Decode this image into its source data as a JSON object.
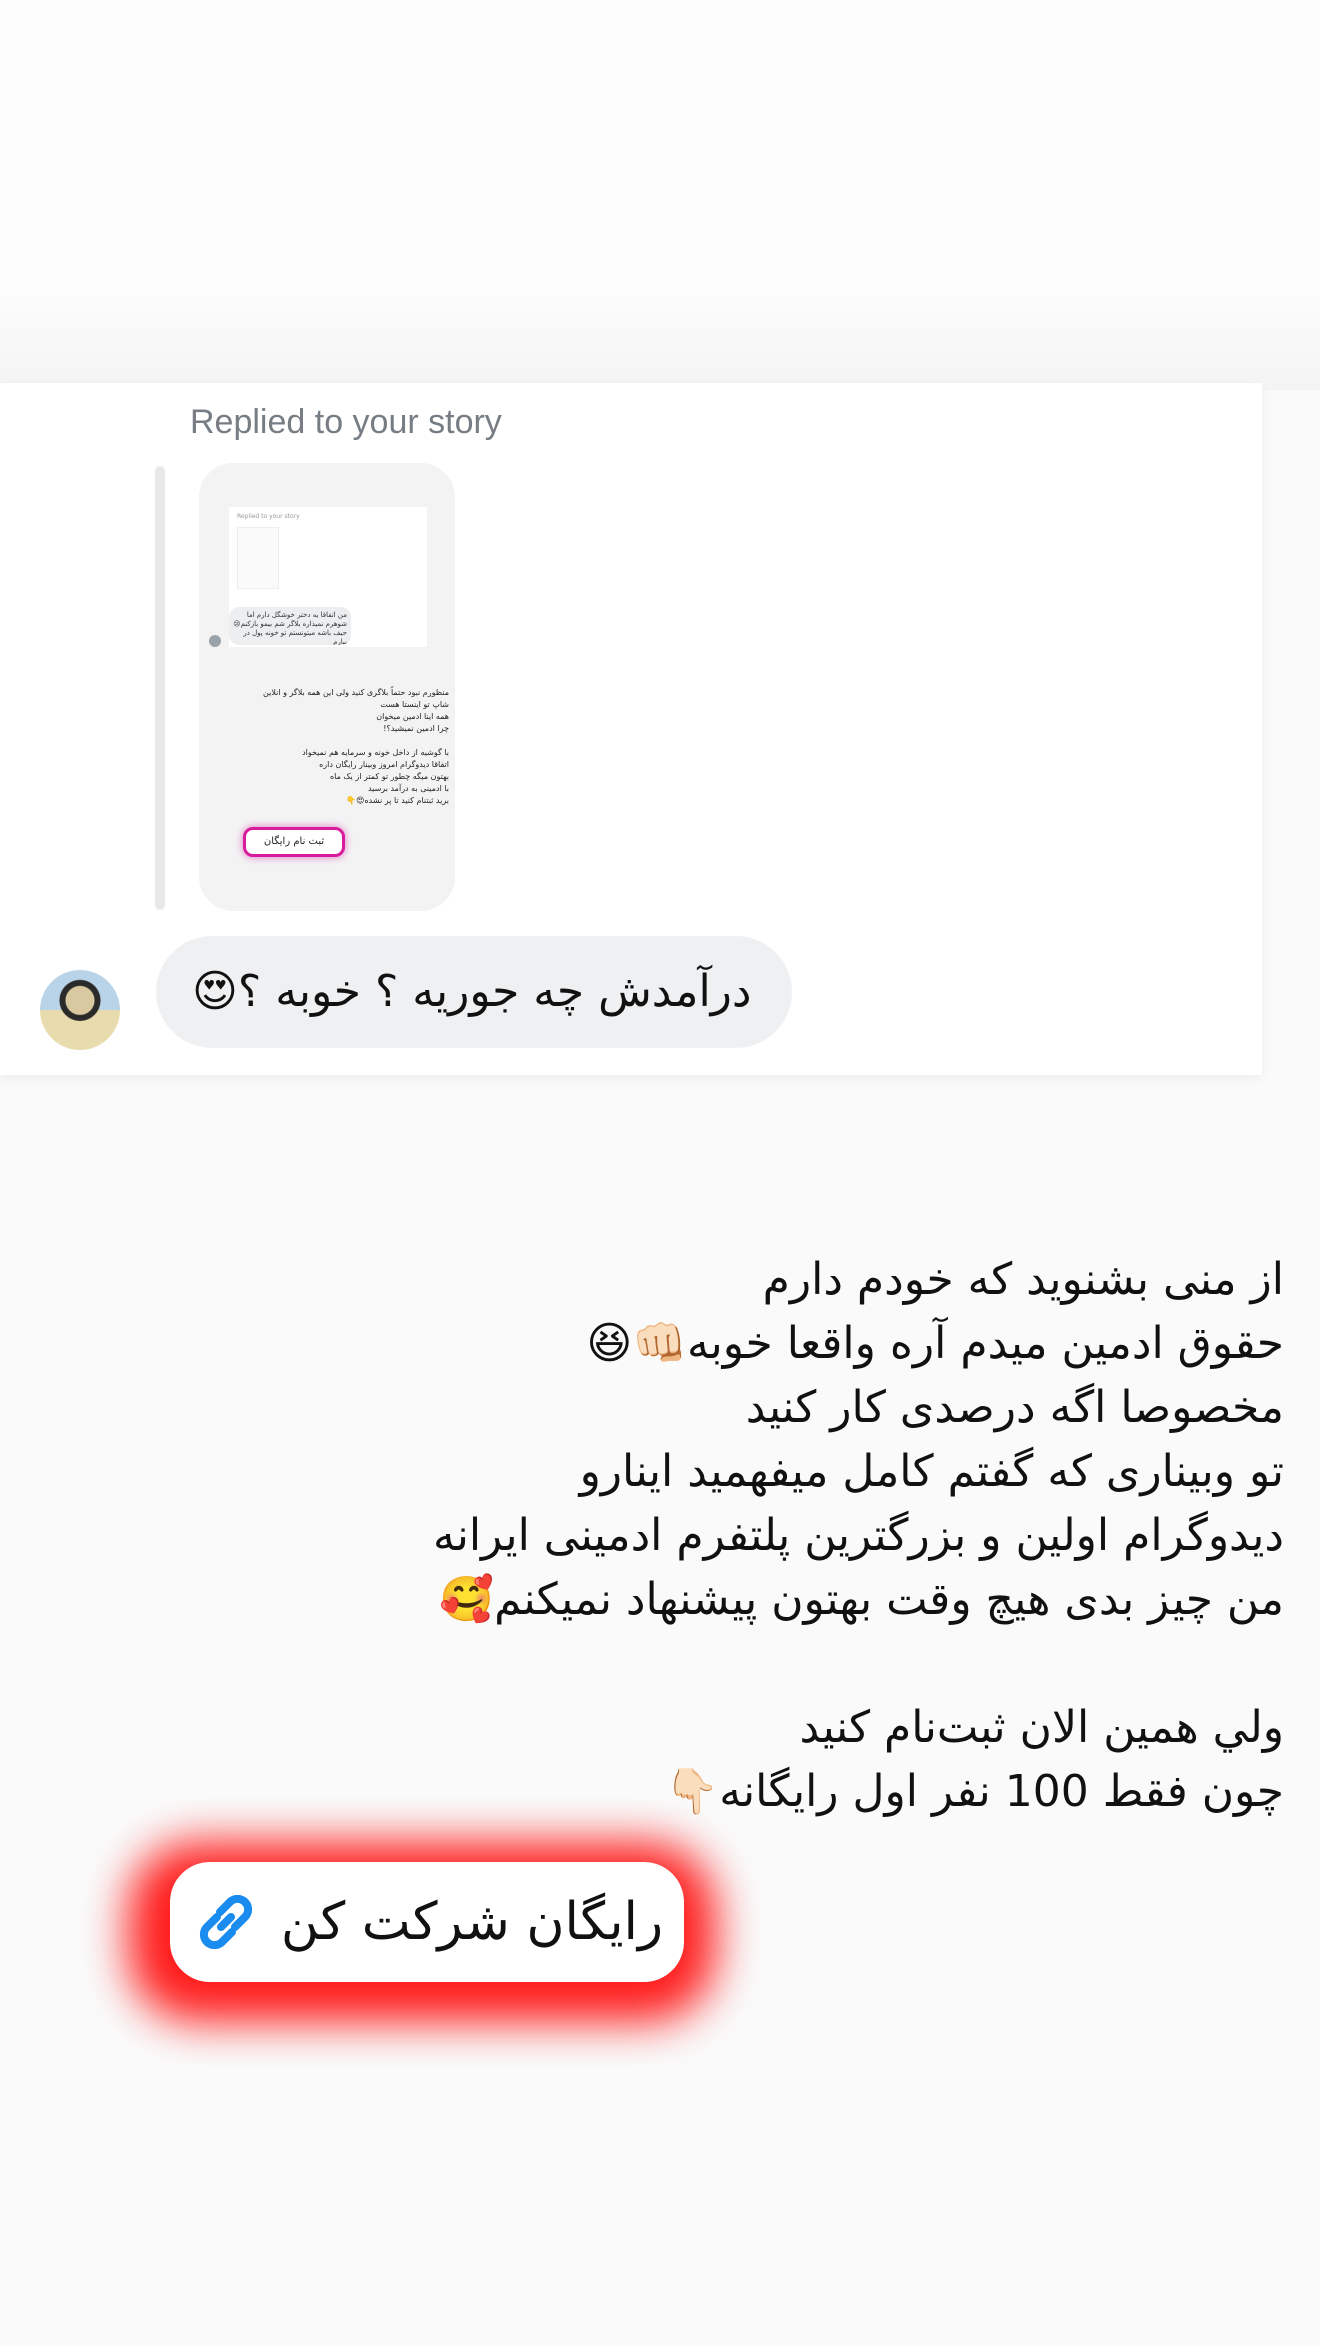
{
  "story_reply": {
    "label": "Replied to your story",
    "thumbnail": {
      "inner_label": "Replied to your story",
      "bubble_text": "من اتفاقا یه دختر خوشگل دارم اما شوهرم نمیذاره بلاگر شم بیمو بازکنم😢\nحیف باشه میتونستم تو خونه پول در بیارم",
      "caption_text": "منظورم نبود حتماً بلاگری کنید ولی این همه بلاگر و انلاین شاپ تو اینستا هست\nهمه اینا ادمین میخوان\nچرا ادمین نمیشید؟!\n\nبا گوشیه از داخل خونه و سرمایه هم نمیخواد\nاتفاقا دیدوگرام امروز وبینار رایگان داره\nبهتون میگه چطور تو کمتر از یک ماه\nبا ادمینی به درآمد برسید\nبرید ثبتنام کنید تا پر نشده😍👇",
      "pill_label": "ثبت نام رایگان"
    }
  },
  "message": {
    "text": "درآمدش چه جوریه ؟ خوبه ؟😍"
  },
  "caption": {
    "text": "از منی بشنوید که خودم دارم\n حقوق ادمین میدم آره واقعا خوبه👊🏻😆\nمخصوصا اگه درصدی کار کنید\nتو وبیناری که گفتم کامل میفهمید اینارو\nدیدوگرام اولین و بزرگترین پلتفرم ادمینی ایرانه\nمن چیز بدی هیچ وقت بهتون پیشنهاد نمیکنم🥰\n\nولي همين الان ثبت‌نام كنيد\nچون فقط 100 نفر اول رایگانه👇🏻"
  },
  "cta": {
    "label": "رایگان شرکت کن",
    "icon": "link-icon",
    "icon_color": "#1a8cf0",
    "glow_color": "#ff1010"
  },
  "colors": {
    "pill_border": "#d81b9c",
    "bubble_bg": "#eff0f2",
    "label_gray": "#777d84"
  }
}
